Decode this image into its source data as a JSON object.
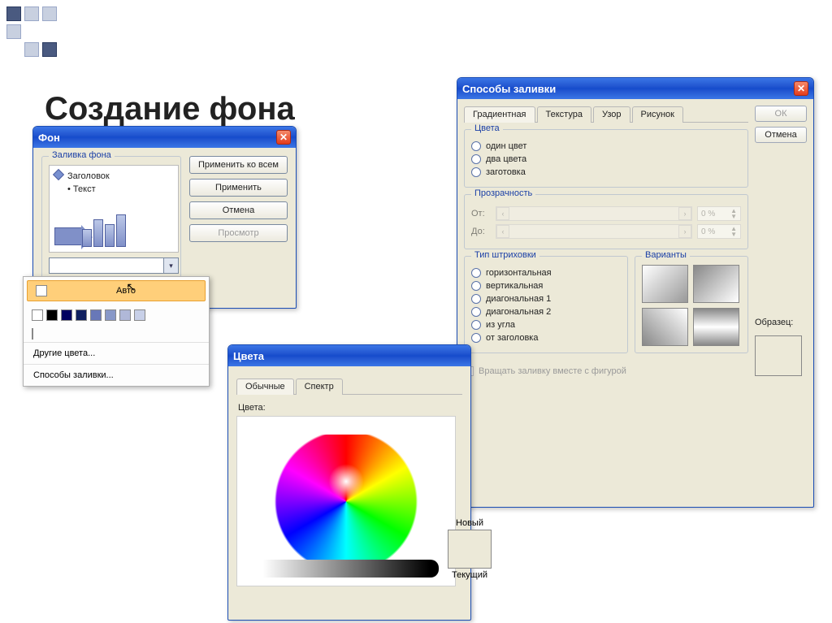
{
  "slide": {
    "title": "Создание фона"
  },
  "bgWin": {
    "title": "Фон",
    "group_label": "Заливка фона",
    "preview": {
      "heading": "Заголовок",
      "bullet": "Текст"
    },
    "buttons": {
      "apply_all": "Применить ко всем",
      "apply": "Применить",
      "cancel": "Отмена",
      "preview": "Просмотр"
    }
  },
  "flyout": {
    "auto": "Авто",
    "palette_row": [
      "#ffffff",
      "#000000",
      "#000060",
      "#102060",
      "#6878b8",
      "#8898c8",
      "#b0b8d8",
      "#c8d0e8"
    ],
    "more_colors": "Другие цвета...",
    "fill_effects": "Способы заливки..."
  },
  "colorsWin": {
    "title": "Цвета",
    "tabs": {
      "standard": "Обычные",
      "spectrum": "Спектр"
    },
    "colors_label": "Цвета:"
  },
  "newCurrent": {
    "new_label": "Новый",
    "current_label": "Текущий"
  },
  "fillWin": {
    "title": "Способы заливки",
    "tabs": {
      "gradient": "Градиентная",
      "texture": "Текстура",
      "pattern": "Узор",
      "picture": "Рисунок"
    },
    "buttons": {
      "ok": "ОК",
      "cancel": "Отмена"
    },
    "groups": {
      "colors": "Цвета",
      "transparency": "Прозрачность",
      "hatch": "Тип штриховки",
      "variants": "Варианты"
    },
    "color_opts": {
      "one": "один цвет",
      "two": "два цвета",
      "preset": "заготовка"
    },
    "transparency": {
      "from": "От:",
      "to": "До:",
      "percent": "0 %"
    },
    "hatch_opts": {
      "horizontal": "горизонтальная",
      "vertical": "вертикальная",
      "diag1": "диагональная 1",
      "diag2": "диагональная 2",
      "corner": "из угла",
      "title": "от заголовка"
    },
    "sample_label": "Образец:",
    "rotate_label": "Вращать заливку вместе с фигурой"
  }
}
